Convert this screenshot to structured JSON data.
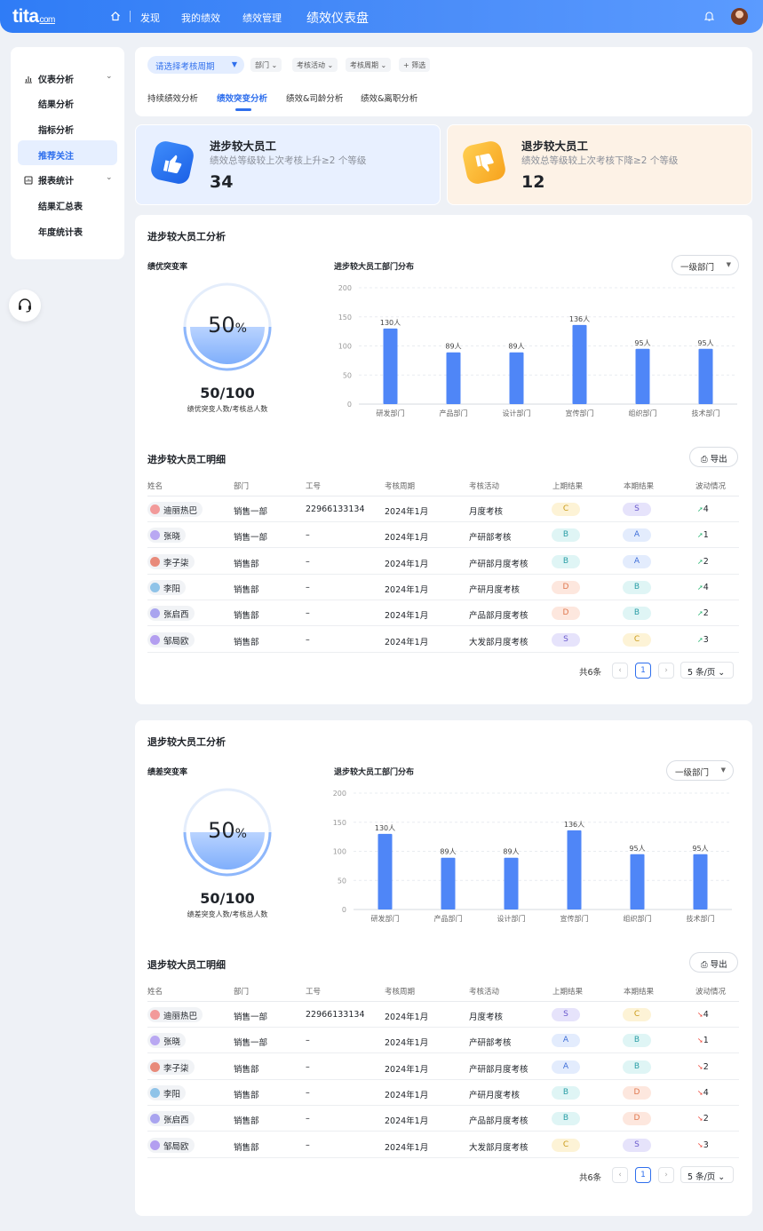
{
  "topbar": {
    "logo": "tita",
    "logo_suffix": "com",
    "nav": [
      "发现",
      "我的绩效",
      "绩效管理"
    ],
    "current": "绩效仪表盘"
  },
  "sidebar": {
    "groups": [
      {
        "label": "仪表分析",
        "icon": "bar-chart-icon",
        "items": [
          "结果分析",
          "指标分析",
          "推荐关注"
        ]
      },
      {
        "label": "报表统计",
        "icon": "report-icon",
        "items": [
          "结果汇总表",
          "年度统计表"
        ]
      }
    ],
    "active_item": "推荐关注"
  },
  "filters": {
    "period_placeholder": "请选择考核周期",
    "chips": [
      "部门",
      "考核活动",
      "考核周期",
      "+ 筛选"
    ],
    "tabs": [
      "持续绩效分析",
      "绩效突变分析",
      "绩效&司龄分析",
      "绩效&离职分析"
    ],
    "active_tab": "绩效突变分析"
  },
  "stats": [
    {
      "title": "进步较大员工",
      "subtitle": "绩效总等级较上次考核上升≥2 个等级",
      "value": "34",
      "icon": "thumbs-up-icon"
    },
    {
      "title": "退步较大员工",
      "subtitle": "绩效总等级较上次考核下降≥2 个等级",
      "value": "12",
      "icon": "thumbs-down-icon"
    }
  ],
  "sections": [
    {
      "title": "进步较大员工分析",
      "rate_label": "绩优突变率",
      "rate_value": "50",
      "rate_unit": "%",
      "rate_fraction": 0.5,
      "ratio": "50/100",
      "ratio_caption": "绩优突变人数/考核总人数",
      "chart_title": "进步较大员工部门分布",
      "dropdown": "一级部门",
      "detail_title": "进步较大员工明细",
      "export_label": "导出",
      "headers": [
        "姓名",
        "部门",
        "工号",
        "考核周期",
        "考核活动",
        "上期结果",
        "本期结果",
        "波动情况"
      ],
      "rows": [
        {
          "name": "迪丽热巴",
          "dept": "销售一部",
          "id": "22966133134",
          "period": "2024年1月",
          "activity": "月度考核",
          "prev": "C",
          "curr": "S",
          "change": "4",
          "dir": "up"
        },
        {
          "name": "张晓",
          "dept": "销售一部",
          "id": "–",
          "period": "2024年1月",
          "activity": "产研部考核",
          "prev": "B",
          "curr": "A",
          "change": "1",
          "dir": "up"
        },
        {
          "name": "李子柒",
          "dept": "销售部",
          "id": "–",
          "period": "2024年1月",
          "activity": "产研部月度考核",
          "prev": "B",
          "curr": "A",
          "change": "2",
          "dir": "up"
        },
        {
          "name": "李阳",
          "dept": "销售部",
          "id": "–",
          "period": "2024年1月",
          "activity": "产研月度考核",
          "prev": "D",
          "curr": "B",
          "change": "4",
          "dir": "up"
        },
        {
          "name": "张启西",
          "dept": "销售部",
          "id": "–",
          "period": "2024年1月",
          "activity": "产品部月度考核",
          "prev": "D",
          "curr": "B",
          "change": "2",
          "dir": "up"
        },
        {
          "name": "邹局欧",
          "dept": "销售部",
          "id": "–",
          "period": "2024年1月",
          "activity": "大发部月度考核",
          "prev": "S",
          "curr": "C",
          "change": "3",
          "dir": "up"
        }
      ],
      "pager": {
        "total": "共6条",
        "page": "1",
        "size": "5 条/页"
      }
    },
    {
      "title": "退步较大员工分析",
      "rate_label": "绩差突变率",
      "rate_value": "50",
      "rate_unit": "%",
      "rate_fraction": 0.5,
      "ratio": "50/100",
      "ratio_caption": "绩差突变人数/考核总人数",
      "chart_title": "退步较大员工部门分布",
      "dropdown": "一级部门",
      "detail_title": "退步较大员工明细",
      "export_label": "导出",
      "headers": [
        "姓名",
        "部门",
        "工号",
        "考核周期",
        "考核活动",
        "上期结果",
        "本期结果",
        "波动情况"
      ],
      "rows": [
        {
          "name": "迪丽热巴",
          "dept": "销售一部",
          "id": "22966133134",
          "period": "2024年1月",
          "activity": "月度考核",
          "prev": "S",
          "curr": "C",
          "change": "4",
          "dir": "down"
        },
        {
          "name": "张晓",
          "dept": "销售一部",
          "id": "–",
          "period": "2024年1月",
          "activity": "产研部考核",
          "prev": "A",
          "curr": "B",
          "change": "1",
          "dir": "down"
        },
        {
          "name": "李子柒",
          "dept": "销售部",
          "id": "–",
          "period": "2024年1月",
          "activity": "产研部月度考核",
          "prev": "A",
          "curr": "B",
          "change": "2",
          "dir": "down"
        },
        {
          "name": "李阳",
          "dept": "销售部",
          "id": "–",
          "period": "2024年1月",
          "activity": "产研月度考核",
          "prev": "B",
          "curr": "D",
          "change": "4",
          "dir": "down"
        },
        {
          "name": "张启西",
          "dept": "销售部",
          "id": "–",
          "period": "2024年1月",
          "activity": "产品部月度考核",
          "prev": "B",
          "curr": "D",
          "change": "2",
          "dir": "down"
        },
        {
          "name": "邹局欧",
          "dept": "销售部",
          "id": "–",
          "period": "2024年1月",
          "activity": "大发部月度考核",
          "prev": "C",
          "curr": "S",
          "change": "3",
          "dir": "down"
        }
      ],
      "pager": {
        "total": "共6条",
        "page": "1",
        "size": "5 条/页"
      }
    }
  ],
  "chart_data": [
    {
      "type": "bar",
      "title": "进步较大员工部门分布",
      "categories": [
        "研发部门",
        "产品部门",
        "设计部门",
        "宣传部门",
        "组织部门",
        "技术部门"
      ],
      "values": [
        130,
        89,
        89,
        136,
        95,
        95
      ],
      "data_labels": [
        "130人",
        "89人",
        "89人",
        "136人",
        "95人",
        "95人"
      ],
      "yticks": [
        "0",
        "50",
        "100",
        "150",
        "200"
      ],
      "ylim": [
        0,
        200
      ],
      "grid": true,
      "color": "#4f86f7"
    },
    {
      "type": "bar",
      "title": "退步较大员工部门分布",
      "categories": [
        "研发部门",
        "产品部门",
        "设计部门",
        "宣传部门",
        "组织部门",
        "技术部门"
      ],
      "values": [
        130,
        89,
        89,
        136,
        95,
        95
      ],
      "data_labels": [
        "130人",
        "89人",
        "89人",
        "136人",
        "95人",
        "95人"
      ],
      "yticks": [
        "0",
        "50",
        "100",
        "150",
        "200"
      ],
      "ylim": [
        0,
        200
      ],
      "grid": true,
      "color": "#4f86f7"
    }
  ],
  "grade_colors": {
    "S": {
      "bg": "#e6e3fb",
      "fg": "#6a5acd"
    },
    "A": {
      "bg": "#e3ecfd",
      "fg": "#3f6fd8"
    },
    "B": {
      "bg": "#dff5f5",
      "fg": "#2b9ea6"
    },
    "C": {
      "bg": "#fdf3d6",
      "fg": "#c99a17"
    },
    "D": {
      "bg": "#fde7de",
      "fg": "#e0784f"
    }
  }
}
